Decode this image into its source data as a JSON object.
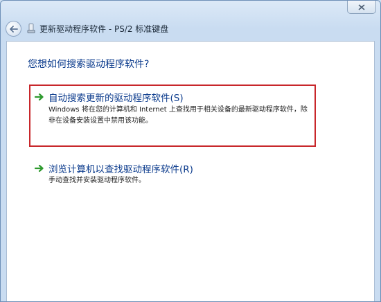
{
  "window": {
    "title": "更新驱动程序软件 - PS/2 标准键盘"
  },
  "content": {
    "question": "您想如何搜索驱动程序软件?",
    "options": [
      {
        "title": "自动搜索更新的驱动程序软件(S)",
        "description": "Windows 将在您的计算机和 Internet 上查找用于相关设备的最新驱动程序软件，除非在设备安装设置中禁用该功能。"
      },
      {
        "title": "浏览计算机以查找驱动程序软件(R)",
        "description": "手动查找并安装驱动程序软件。"
      }
    ]
  },
  "colors": {
    "accent_text": "#0a3a8c",
    "highlight_border": "#c8272b",
    "arrow_green": "#2e9a2e"
  },
  "icons": {
    "back": "back-arrow-icon",
    "close": "close-icon",
    "device": "device-icon",
    "option_arrow": "green-arrow-icon"
  }
}
